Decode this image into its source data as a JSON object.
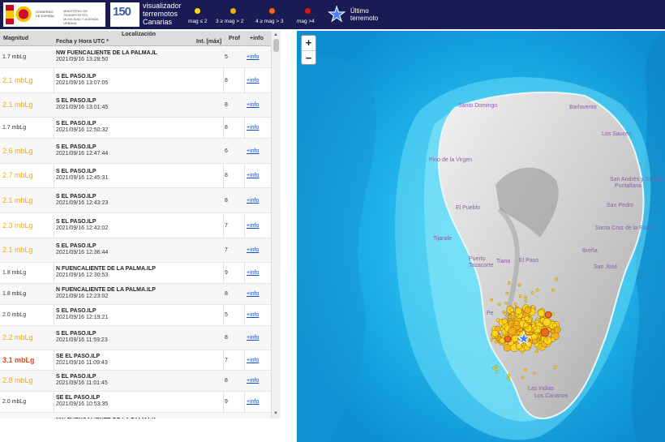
{
  "header": {
    "gov_text_left": "GOBIERNO DE ESPAÑA",
    "gov_text_right": "MINISTERIO DE TRANSPORTES, MOVILIDAD Y AGENDA URBANA",
    "anniv_number": "150",
    "app_title": "visualizador terremotos Canarias",
    "legend": [
      {
        "label": "mag ≤ 2",
        "color": "#ffd21f"
      },
      {
        "label": "3 ≥ mag > 2",
        "color": "#f7a81b"
      },
      {
        "label": "4 ≥ mag > 3",
        "color": "#f06a1b"
      },
      {
        "label": "mag >4",
        "color": "#d8161c"
      }
    ],
    "last_label": "Último terremoto"
  },
  "table": {
    "headers": {
      "mag": "Magnitud",
      "loc": "Localización",
      "date": "Fecha y Hora UTC *",
      "int": "Int. [máx]",
      "prof": "Prof",
      "info": "+info"
    },
    "rows": [
      {
        "mag": "1.7 mbLg",
        "loc": "NW FUENCALIENTE DE LA PALMA.IL",
        "date": "2021/09/16 13:28:50",
        "prof": "5",
        "info": "+info",
        "color": "#333333"
      },
      {
        "mag": "2.1 mbLg",
        "loc": "S EL PASO.ILP",
        "date": "2021/09/16 13:07:05",
        "prof": "8",
        "info": "+info",
        "color": "#f2a61c"
      },
      {
        "mag": "2.1 mbLg",
        "loc": "S EL PASO.ILP",
        "date": "2021/09/16 13:01:45",
        "prof": "8",
        "info": "+info",
        "color": "#f2a61c"
      },
      {
        "mag": "1.7 mbLg",
        "loc": "S EL PASO.ILP",
        "date": "2021/09/16 12:50:32",
        "prof": "8",
        "info": "+info",
        "color": "#333333"
      },
      {
        "mag": "2.6 mbLg",
        "loc": "S EL PASO.ILP",
        "date": "2021/09/16 12:47:44",
        "prof": "6",
        "info": "+info",
        "color": "#f2a61c"
      },
      {
        "mag": "2.7 mbLg",
        "loc": "S EL PASO.ILP",
        "date": "2021/09/16 12:45:31",
        "prof": "8",
        "info": "+info",
        "color": "#f2a61c"
      },
      {
        "mag": "2.1 mbLg",
        "loc": "S EL PASO.ILP",
        "date": "2021/09/16 12:43:23",
        "prof": "8",
        "info": "+info",
        "color": "#f2a61c"
      },
      {
        "mag": "2.3 mbLg",
        "loc": "S EL PASO.ILP",
        "date": "2021/09/16 12:42:02",
        "prof": "7",
        "info": "+info",
        "color": "#f2a61c"
      },
      {
        "mag": "2.1 mbLg",
        "loc": "S EL PASO.ILP",
        "date": "2021/09/16 12:36:44",
        "prof": "7",
        "info": "+info",
        "color": "#f2a61c"
      },
      {
        "mag": "1.8 mbLg",
        "loc": "N FUENCALIENTE DE LA PALMA.ILP",
        "date": "2021/09/16 12:30:53",
        "prof": "9",
        "info": "+info",
        "color": "#333333"
      },
      {
        "mag": "1.8 mbLg",
        "loc": "N FUENCALIENTE DE LA PALMA.ILP",
        "date": "2021/09/16 12:23:02",
        "prof": "8",
        "info": "+info",
        "color": "#333333"
      },
      {
        "mag": "2.0 mbLg",
        "loc": "S EL PASO.ILP",
        "date": "2021/09/16 12:19:21",
        "prof": "5",
        "info": "+info",
        "color": "#333333"
      },
      {
        "mag": "2.2 mbLg",
        "loc": "S EL PASO.ILP",
        "date": "2021/09/16 11:59:23",
        "prof": "8",
        "info": "+info",
        "color": "#f2a61c"
      },
      {
        "mag": "3.1 mbLg",
        "loc": "SE EL PASO.ILP",
        "date": "2021/09/16 11:09:43",
        "prof": "7",
        "info": "+info",
        "color": "#e8461c"
      },
      {
        "mag": "2.8 mbLg",
        "loc": "S EL PASO.ILP",
        "date": "2021/09/16 11:01:45",
        "prof": "8",
        "info": "+info",
        "color": "#f2a61c"
      },
      {
        "mag": "2.0 mbLg",
        "loc": "SE EL PASO.ILP",
        "date": "2021/09/16 10:53:35",
        "prof": "9",
        "info": "+info",
        "color": "#333333"
      },
      {
        "mag": "",
        "loc": "NW FUENCALIENTE DE LA PALMA.IL",
        "date": "",
        "prof": "",
        "info": "",
        "color": "#333333"
      }
    ]
  },
  "map": {
    "zoom_in": "+",
    "zoom_out": "−",
    "places": [
      "Santo Domingo",
      "Barlovento",
      "Los Sauces",
      "San Andrés y Sauces",
      "Puntallana",
      "Pino de la Virgen",
      "San Pedro",
      "Santa Cruz de la Palma",
      "El Pueblo",
      "Breña",
      "Puerto",
      "Tijarafe",
      "Tazacorte",
      "Tiana",
      "El Paso",
      "San José",
      "Pe",
      "Las Indias",
      "Los Canarios"
    ]
  }
}
